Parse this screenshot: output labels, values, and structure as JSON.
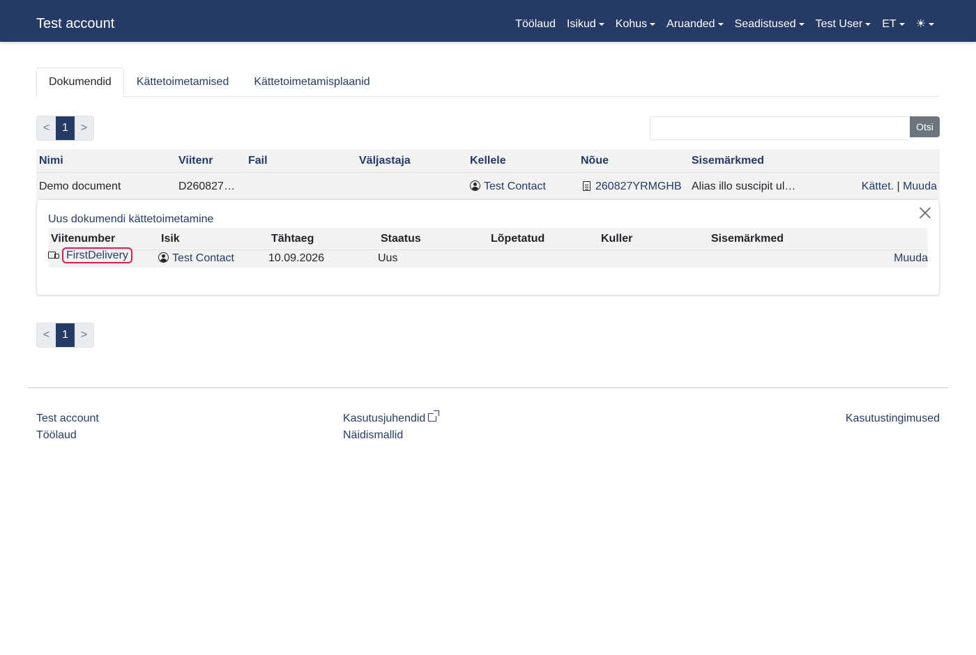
{
  "navbar": {
    "brand": "Test account",
    "items": [
      {
        "label": "Töölaud"
      },
      {
        "label": "Isikud"
      },
      {
        "label": "Kohus"
      },
      {
        "label": "Aruanded"
      },
      {
        "label": "Seadistused"
      },
      {
        "label": "Test User"
      },
      {
        "label": "ET"
      }
    ],
    "theme_icon": "☀"
  },
  "tabs": [
    "Dokumendid",
    "Kättetoimetamised",
    "Kättetoimetamisplaanid"
  ],
  "pagination": {
    "prev": "<",
    "current": "1",
    "next": ">"
  },
  "search": {
    "value": "",
    "button": "Otsi"
  },
  "table": {
    "headers": [
      "Nimi",
      "Viitenr",
      "Fail",
      "Väljastaja",
      "Kellele",
      "Nõue",
      "Sisemärkmed"
    ],
    "row": {
      "name": "Demo document",
      "ref": "D260827…",
      "recipient": "Test Contact",
      "claim": "260827YRMGHB",
      "notes": "Alias illo suscipit ul…",
      "action_deliver": "Kättet.",
      "separator": "|",
      "action_edit": "Muuda"
    }
  },
  "detail": {
    "title": "Uus dokumendi kättetoimetamine",
    "headers": [
      "Viitenumber",
      "Isik",
      "Tähtaeg",
      "Staatus",
      "Lõpetatud",
      "Kuller",
      "Sisemärkmed"
    ],
    "row": {
      "ref": "FirstDelivery",
      "person": "Test Contact",
      "deadline": "10.09.2026",
      "status": "Uus",
      "action_edit": "Muuda"
    }
  },
  "footer": {
    "col1": [
      "Test account",
      "Töölaud"
    ],
    "col2": [
      "Kasutusjuhendid",
      "Näidismallid"
    ],
    "col3": [
      "Kasutustingimused"
    ]
  },
  "colors": {
    "primary": "#253b66",
    "highlight": "#d6204f"
  }
}
